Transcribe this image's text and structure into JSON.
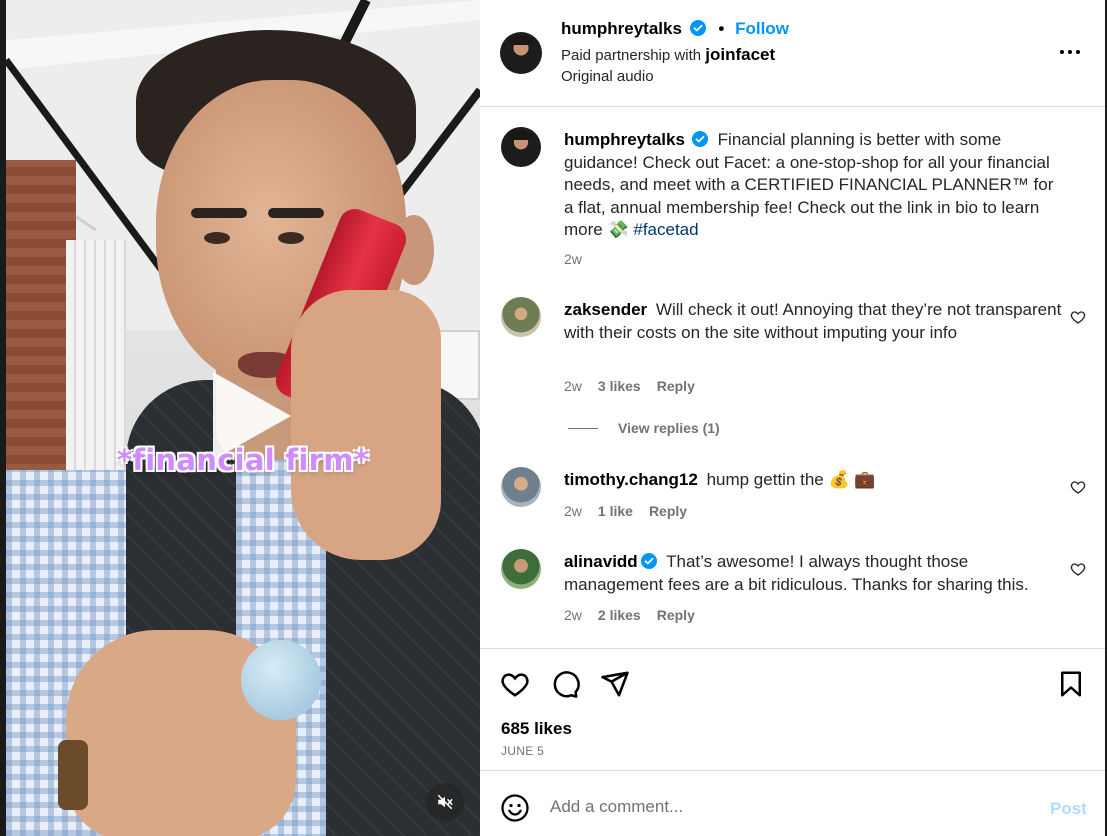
{
  "video": {
    "caption": "*financial firm*"
  },
  "header": {
    "username": "humphreytalks",
    "follow_label": "Follow",
    "partnership_prefix": "Paid partnership with",
    "partner": "joinfacet",
    "audio": "Original audio"
  },
  "post_caption": {
    "username": "humphreytalks",
    "text": "Financial planning is better with some guidance! Check out Facet: a one-stop-shop for all your financial needs, and meet with a CERTIFIED FINANCIAL PLANNER™ for a flat, annual membership fee! Check out the link in bio to learn more 💸",
    "hashtag": "#facetad",
    "age": "2w"
  },
  "comments": [
    {
      "username": "zaksender",
      "verified": false,
      "text": "Will check it out! Annoying that they’re not transparent with their costs on the site without imputing your info",
      "age": "2w",
      "likes": "3 likes",
      "reply": "Reply"
    },
    {
      "username": "timothy.chang12",
      "verified": false,
      "text": "hump gettin the 💰 💼",
      "age": "2w",
      "likes": "1 like",
      "reply": "Reply"
    },
    {
      "username": "alinavidd",
      "verified": true,
      "text": "That’s awesome! I always thought those management fees are a bit ridiculous. Thanks for sharing this.",
      "age": "2w",
      "likes": "2 likes",
      "reply": "Reply"
    }
  ],
  "view_replies": "View replies (1)",
  "likes_count": "685 likes",
  "post_date": "JUNE 5",
  "comment_box": {
    "placeholder": "Add a comment...",
    "post_label": "Post"
  },
  "colors": {
    "link_blue": "#0095f6",
    "verified_blue": "#0095f6",
    "caption_purple": "#d08bff",
    "muted_text": "#737373"
  },
  "icons": [
    "verified-icon",
    "more-options-icon",
    "heart-icon",
    "comment-icon",
    "share-icon",
    "bookmark-icon",
    "emoji-icon",
    "muted-speaker-icon",
    "play-icon"
  ]
}
